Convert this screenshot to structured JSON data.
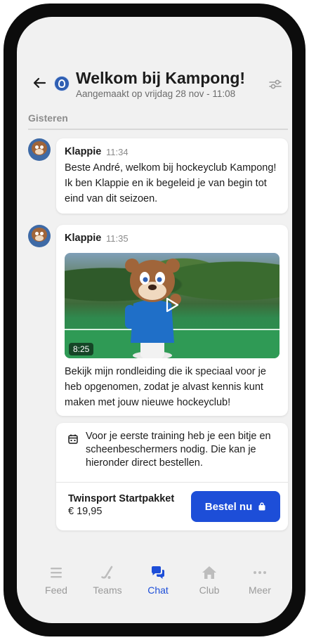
{
  "header": {
    "title": "Welkom bij Kampong!",
    "subtitle": "Aangemaakt op vrijdag 28 nov - 11:08"
  },
  "date_separator": "Gisteren",
  "messages": [
    {
      "sender": "Klappie",
      "time": "11:34",
      "text": "Beste André, welkom bij hockeyclub Kampong! Ik ben Klappie en ik begeleid je van begin tot eind van dit seizoen."
    },
    {
      "sender": "Klappie",
      "time": "11:35",
      "video_duration": "8:25",
      "text": "Bekijk mijn rondleiding die ik speciaal voor je heb opgenomen, zodat je alvast kennis kunt maken met jouw nieuwe hockeyclub!"
    }
  ],
  "order_card": {
    "text": "Voor je eerste training heb je een bitje en scheenbeschermers nodig. Die kan je hieronder direct bestellen.",
    "product_name": "Twinsport Startpakket",
    "price": "€ 19,95",
    "button_label": "Bestel nu"
  },
  "nav": {
    "items": [
      {
        "label": "Feed",
        "icon": "list-icon"
      },
      {
        "label": "Teams",
        "icon": "hockey-stick-icon"
      },
      {
        "label": "Chat",
        "icon": "chat-bubbles-icon"
      },
      {
        "label": "Club",
        "icon": "home-icon"
      },
      {
        "label": "Meer",
        "icon": "more-icon"
      }
    ],
    "active": "Chat"
  },
  "colors": {
    "accent": "#1d4ed8",
    "background": "#f1f1f1",
    "frame": "#0c0c0c"
  }
}
